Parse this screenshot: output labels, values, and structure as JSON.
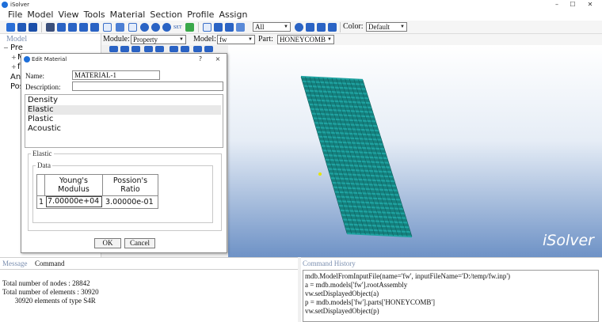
{
  "window": {
    "title": "iSolver"
  },
  "menu": [
    "File",
    "Model",
    "View",
    "Tools",
    "Material",
    "Section",
    "Profile",
    "Assign"
  ],
  "toolbar": {
    "display_filter": "All",
    "color_label": "Color:",
    "color_value": "Default",
    "set_label": "SET"
  },
  "context": {
    "module_label": "Module:",
    "module_value": "Property",
    "model_label": "Model:",
    "model_value": "fw",
    "part_label": "Part:",
    "part_value": "HONEYCOMB"
  },
  "tree": {
    "header": "Model",
    "items": [
      "Pre",
      "M",
      "f",
      "Ana",
      "Pos"
    ]
  },
  "dialog": {
    "title": "Edit Material",
    "help": "?",
    "close": "×",
    "name_label": "Name:",
    "name_value": "MATERIAL-1",
    "description_label": "Description:",
    "description_value": "",
    "behaviors": [
      "Density",
      "Elastic",
      "Plastic",
      "Acoustic"
    ],
    "selected_behavior": "Elastic",
    "group_title": "Elastic",
    "data_title": "Data",
    "table": {
      "headers": [
        "Young's Modulus",
        "Possion's Ratio"
      ],
      "rows": [
        {
          "index": "1",
          "values": [
            "7.00000e+04",
            "3.00000e-01"
          ]
        }
      ]
    },
    "ok_label": "OK",
    "cancel_label": "Cancel"
  },
  "viewport": {
    "brand": "iSolver"
  },
  "message_panel": {
    "tabs": [
      "Message",
      "Command"
    ],
    "lines": [
      "Total number of nodes : 28842",
      "Total number of elements : 30920",
      "       30920 elements of type S4R"
    ]
  },
  "command_history": {
    "title": "Command History",
    "lines": [
      "mdb.ModelFromInputFile(name='fw', inputFileName='D:/temp/fw.inp')",
      "a = mdb.models['fw'].rootAssembly",
      "vw.setDisplayedObject(a)",
      "p = mdb.models['fw'].parts['HONEYCOMB']",
      "vw.setDisplayedObject(p)"
    ]
  },
  "colors": {
    "accent": "#1e6fd9",
    "mesh": "#1fa3a1",
    "viewport_bottom": "#6e92c6"
  }
}
